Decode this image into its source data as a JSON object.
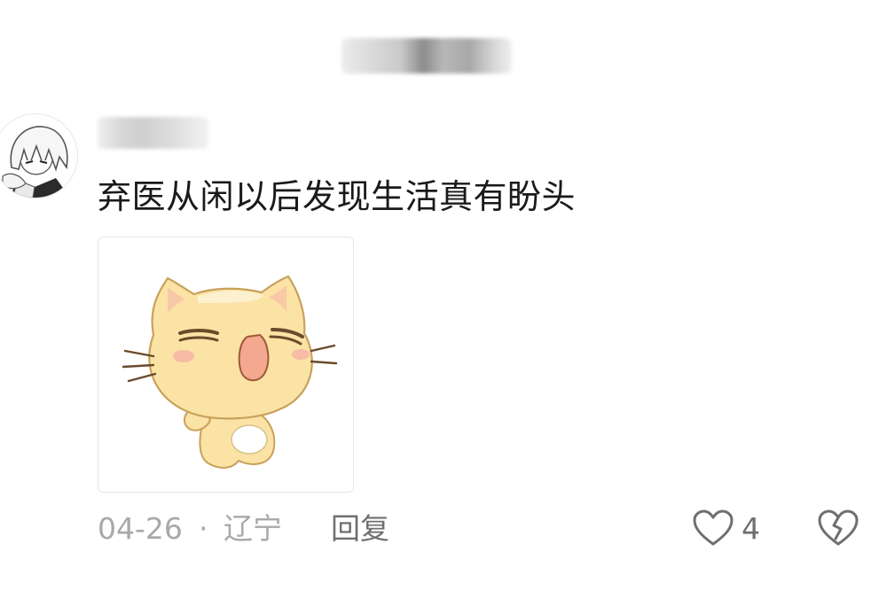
{
  "comment": {
    "text": "弃医从闲以后发现生活真有盼头",
    "date": "04-26",
    "separator": "·",
    "location": "辽宁",
    "reply_label": "回复",
    "like_count": "4"
  },
  "icons": {
    "like": "heart-outline-icon",
    "dislike": "broken-heart-icon"
  },
  "colors": {
    "text": "#1a1a1a",
    "meta": "#a9a9a9",
    "action": "#6f6f6f"
  }
}
